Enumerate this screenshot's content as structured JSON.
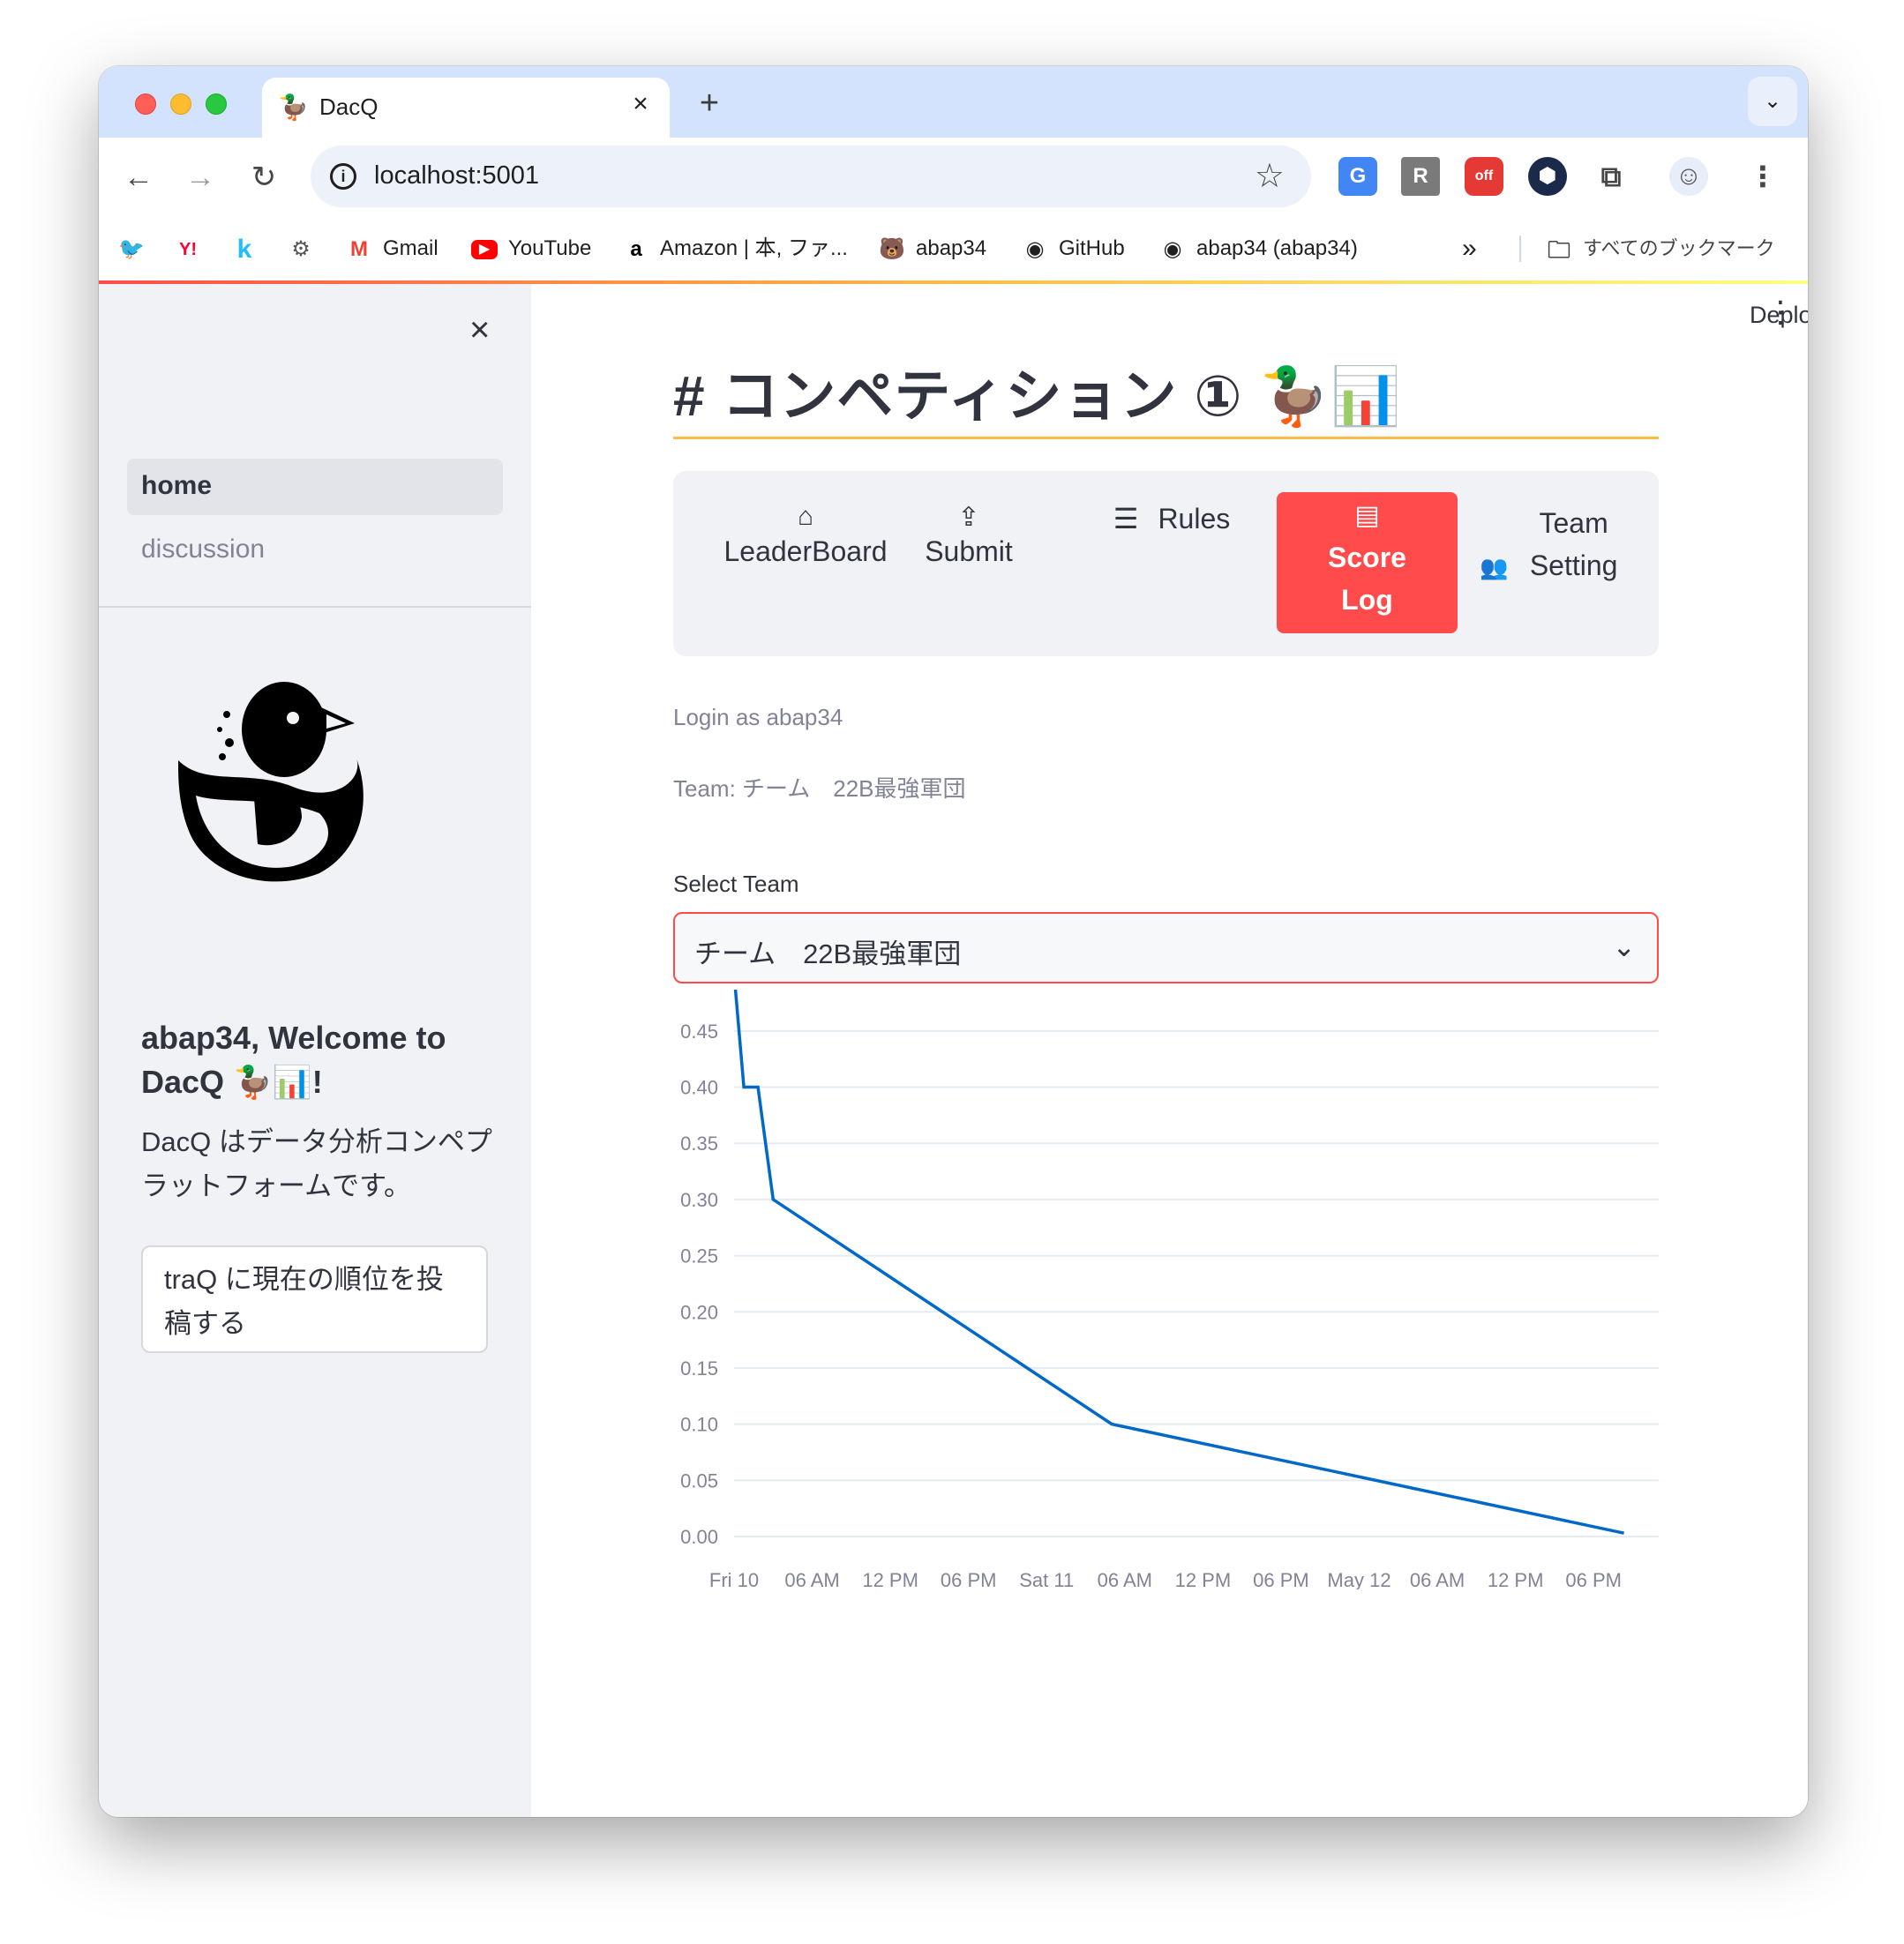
{
  "browser": {
    "tab_title": "DacQ",
    "tab_favicon": "🦆",
    "tab_close": "×",
    "new_tab": "+",
    "tab_search": "⌄",
    "url": "localhost:5001",
    "nav": {
      "back": "←",
      "forward": "→",
      "reload": "↻"
    },
    "star": "☆",
    "extensions": [
      {
        "name": "google-translate-icon",
        "label": "G"
      },
      {
        "name": "r-extension-icon",
        "label": "R"
      },
      {
        "name": "off-extension-icon",
        "label": "off"
      },
      {
        "name": "shield-extension-icon",
        "label": "⬢"
      },
      {
        "name": "puzzle-extensions-icon",
        "label": "⧉"
      },
      {
        "name": "profile-avatar-icon",
        "label": "☺"
      },
      {
        "name": "chrome-menu-icon",
        "label": "⋮"
      }
    ],
    "bookmarks": [
      {
        "name": "twitter",
        "icon": "🐦",
        "label": ""
      },
      {
        "name": "yahoo",
        "icon": "Y!",
        "label": ""
      },
      {
        "name": "kaggle",
        "icon": "k",
        "label": ""
      },
      {
        "name": "atcoder",
        "icon": "⚙",
        "label": ""
      },
      {
        "name": "gmail",
        "icon": "M",
        "label": "Gmail"
      },
      {
        "name": "youtube",
        "icon": "▶",
        "label": "YouTube"
      },
      {
        "name": "amazon",
        "icon": "a",
        "label": "Amazon | 本, ファ..."
      },
      {
        "name": "abap34",
        "icon": "🐻",
        "label": "abap34"
      },
      {
        "name": "github",
        "icon": "◉",
        "label": "GitHub"
      },
      {
        "name": "abap34-github",
        "icon": "◉",
        "label": "abap34 (abap34)"
      }
    ],
    "bookmarks_overflow": "»",
    "all_bookmarks": "すべてのブックマーク"
  },
  "sidebar": {
    "close": "×",
    "nav": [
      {
        "label": "home"
      },
      {
        "label": "discussion"
      }
    ],
    "welcome": "abap34, Welcome to DacQ 🦆📊!",
    "description": "DacQ はデータ分析コンペプラットフォームです。",
    "post_button": "traQ に現在の順位を投稿する"
  },
  "header": {
    "deploy": "Deploy",
    "menu": "⋮"
  },
  "page": {
    "title": "# コンペティション ① 🦆📊",
    "menu": [
      {
        "icon": "⌂",
        "label": "LeaderBoard"
      },
      {
        "icon": "⇪",
        "label": "Submit"
      },
      {
        "icon": "☰",
        "label": "Rules"
      },
      {
        "icon": "▤",
        "label": "Score Log"
      },
      {
        "icon": "👥",
        "label": "Team Setting"
      }
    ],
    "login": "Login as abap34",
    "team": "Team: チーム　22B最強軍団",
    "select_label": "Select Team",
    "select_value": "チーム　22B最強軍団",
    "select_caret": "⌄"
  },
  "colors": {
    "accent": "#ff4b4b",
    "line": "#0068c9",
    "rule": "#ffbd45"
  },
  "chart_data": {
    "type": "line",
    "title": "",
    "xlabel": "",
    "ylabel": "",
    "ylim": [
      0,
      0.475
    ],
    "yticks": [
      0,
      0.05,
      0.1,
      0.15,
      0.2,
      0.25,
      0.3,
      0.35,
      0.4,
      0.45
    ],
    "ytick_labels": [
      "0.00",
      "0.05",
      "0.10",
      "0.15",
      "0.20",
      "0.25",
      "0.30",
      "0.35",
      "0.40",
      "0.45"
    ],
    "xlim": [
      "2024-05-10T00:00",
      "2024-05-12T23:00"
    ],
    "xtick_labels": [
      "Fri 10",
      "06 AM",
      "12 PM",
      "06 PM",
      "Sat 11",
      "06 AM",
      "12 PM",
      "06 PM",
      "May 12",
      "06 AM",
      "12 PM",
      "06 PM"
    ],
    "xticks": [
      "2024-05-10T00:00",
      "2024-05-10T06:00",
      "2024-05-10T12:00",
      "2024-05-10T18:00",
      "2024-05-11T00:00",
      "2024-05-11T06:00",
      "2024-05-11T12:00",
      "2024-05-11T18:00",
      "2024-05-12T00:00",
      "2024-05-12T06:00",
      "2024-05-12T12:00",
      "2024-05-12T18:00"
    ],
    "series": [
      {
        "x": [
          "2024-05-10T00:05",
          "2024-05-10T00:45",
          "2024-05-10T01:50",
          "2024-05-10T03:00",
          "2024-05-11T05:00",
          "2024-05-12T20:20"
        ],
        "y": [
          0.49,
          0.4,
          0.4,
          0.3,
          0.1,
          0.003
        ]
      }
    ],
    "grid": true
  }
}
